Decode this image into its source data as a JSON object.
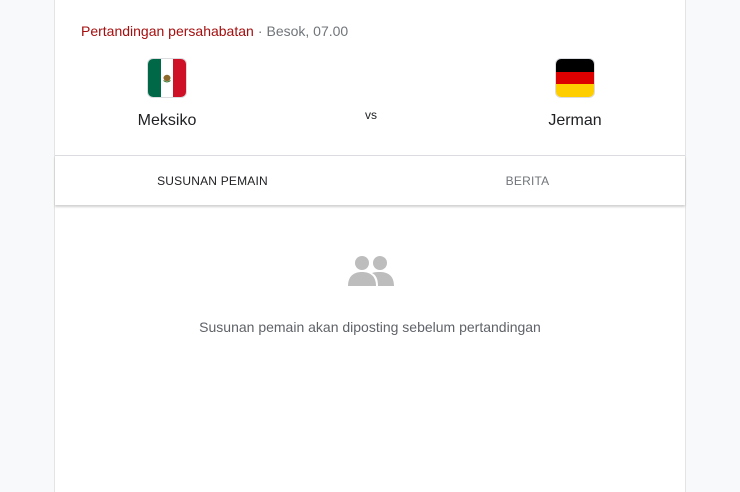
{
  "match": {
    "competition": "Pertandingan persahabatan",
    "separator": "·",
    "time": "Besok, 07.00",
    "vs_label": "vs",
    "home": {
      "name": "Meksiko",
      "flag_icon": "mexico-flag-icon"
    },
    "away": {
      "name": "Jerman",
      "flag_icon": "germany-flag-icon"
    }
  },
  "tabs": [
    {
      "label": "SUSUNAN PEMAIN",
      "active": true
    },
    {
      "label": "BERITA",
      "active": false
    }
  ],
  "empty_state": {
    "icon": "people-icon",
    "message": "Susunan pemain akan diposting sebelum pertandingan"
  },
  "colors": {
    "competition": "#a50e0e",
    "muted_text": "#70757a",
    "icon_gray": "#bdbdbd"
  }
}
